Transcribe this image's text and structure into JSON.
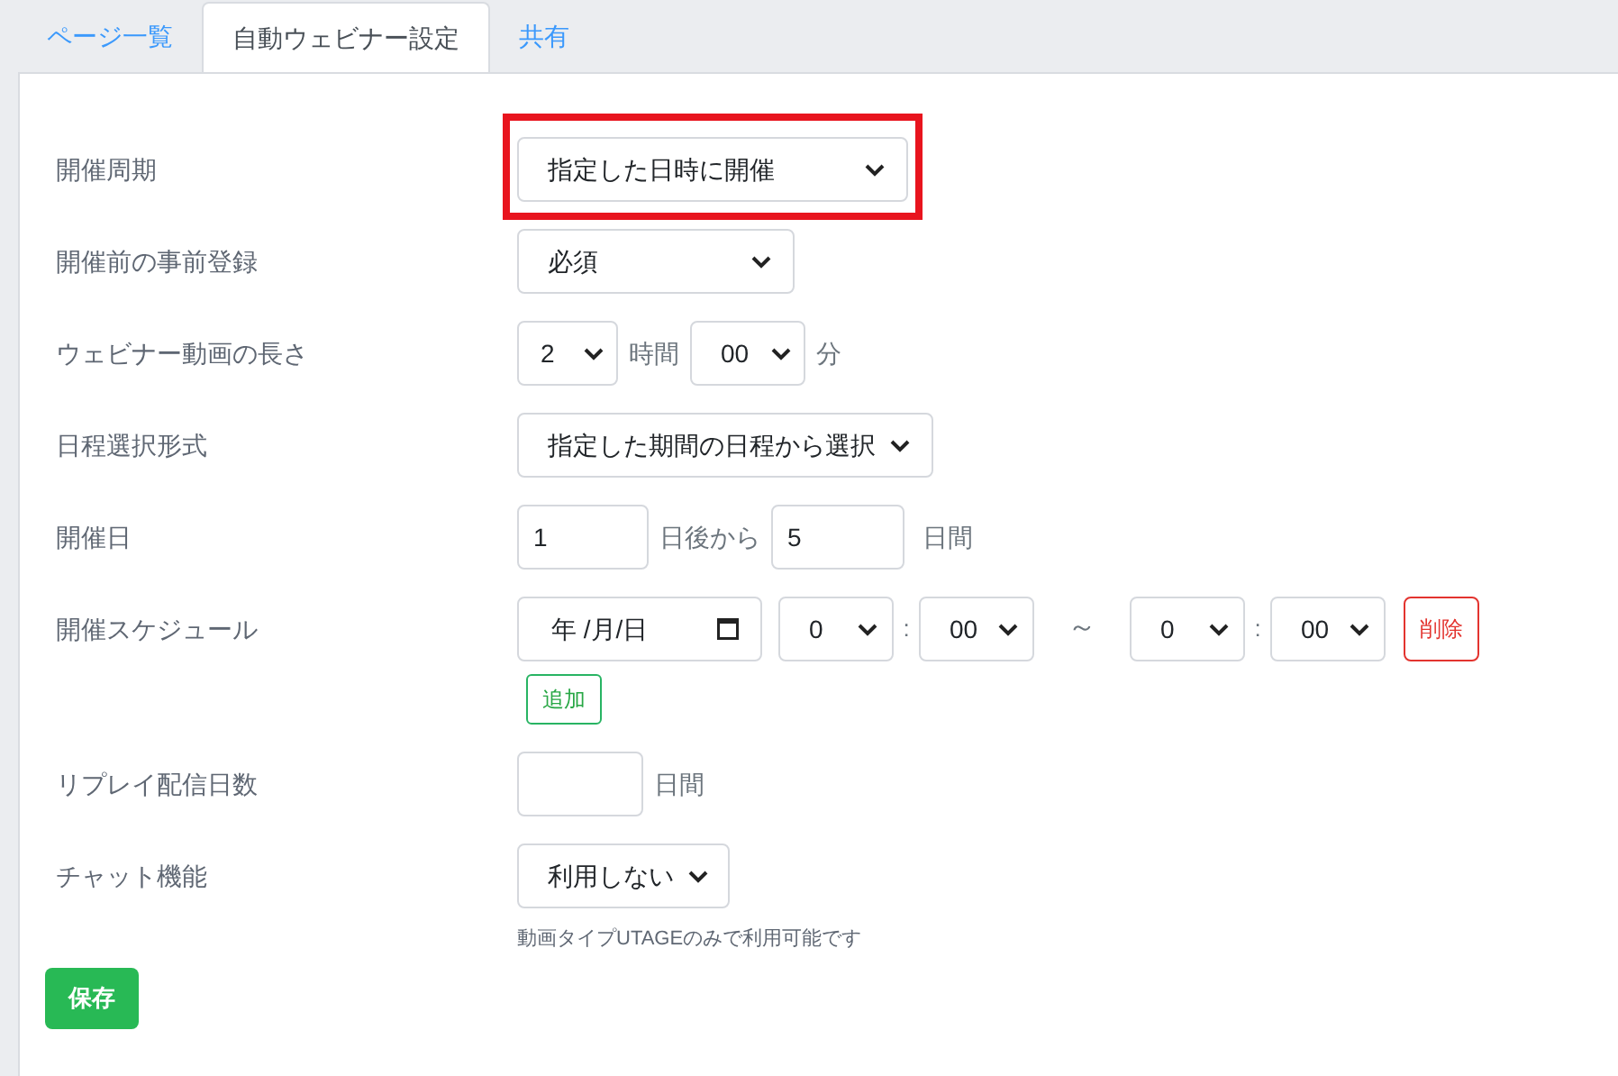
{
  "tabs": [
    {
      "label": "ページ一覧",
      "selected": false
    },
    {
      "label": "自動ウェビナー設定",
      "selected": true
    },
    {
      "label": "共有",
      "selected": false
    }
  ],
  "fields": [
    {
      "kind": "select",
      "label": "開催周期",
      "value": "指定した日時に開催",
      "highlighted": true
    },
    {
      "kind": "select",
      "label": "開催前の事前登録",
      "value": "必須",
      "highlighted": false
    },
    {
      "kind": "duration",
      "label": "ウェビナー動画の長さ",
      "hours": "2",
      "hours_unit": "時間",
      "minutes": "00",
      "minutes_unit": "分"
    },
    {
      "kind": "select",
      "label": "日程選択形式",
      "value": "指定した期間の日程から選択",
      "highlighted": false
    },
    {
      "kind": "range",
      "label": "開催日",
      "start": "1",
      "start_unit": "日後から",
      "length": "5",
      "length_unit": "日間"
    },
    {
      "kind": "schedule",
      "label": "開催スケジュール",
      "date": "年 /月/日",
      "from_hour": "0",
      "from_minute": "00",
      "colon": ":",
      "separator": "～",
      "to_hour": "0",
      "to_minute": "00",
      "delete": "削除",
      "add": "追加"
    },
    {
      "kind": "days",
      "label": "リプレイ配信日数",
      "unit": "日間"
    },
    {
      "kind": "select",
      "label": "チャット機能",
      "value": "利用しない",
      "highlighted": false,
      "note": "動画タイプUTAGEのみで利用可能です"
    }
  ],
  "save": "保存"
}
